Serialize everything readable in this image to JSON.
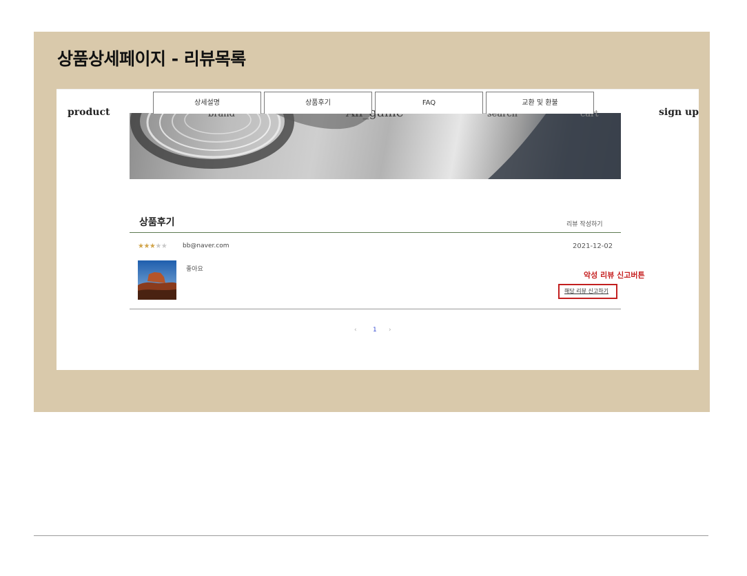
{
  "slide": {
    "title": "상품상세페이지 - 리뷰목록"
  },
  "header": {
    "left_nav": "product",
    "right_nav": "sign up",
    "ghost_labels": [
      "brand",
      "All_game",
      "search",
      "cart"
    ]
  },
  "tabs": [
    {
      "label": "상세설명"
    },
    {
      "label": "상품후기"
    },
    {
      "label": "FAQ"
    },
    {
      "label": "교환 및 환불"
    }
  ],
  "reviews_section": {
    "heading": "상품후기",
    "write_button": "리뷰 작성하기",
    "items": [
      {
        "rating": 3,
        "max_rating": 5,
        "stars_filled": "★★★",
        "stars_empty": "★★",
        "email": "bb@naver.com",
        "date": "2021-12-02",
        "text": "좋아요",
        "thumbnail": "desert-landscape-photo",
        "report_link": "해당 리뷰 신고하기"
      }
    ]
  },
  "annotation": {
    "label": "악성 리뷰 신고버튼",
    "color": "#c62020"
  },
  "pagination": {
    "prev": "‹",
    "current": "1",
    "next": "›",
    "accent": "#3a4fd1"
  },
  "colors": {
    "panel_bg": "#d9c9ab",
    "heading_rule": "#5c7a50",
    "star": "#d1a44a"
  }
}
